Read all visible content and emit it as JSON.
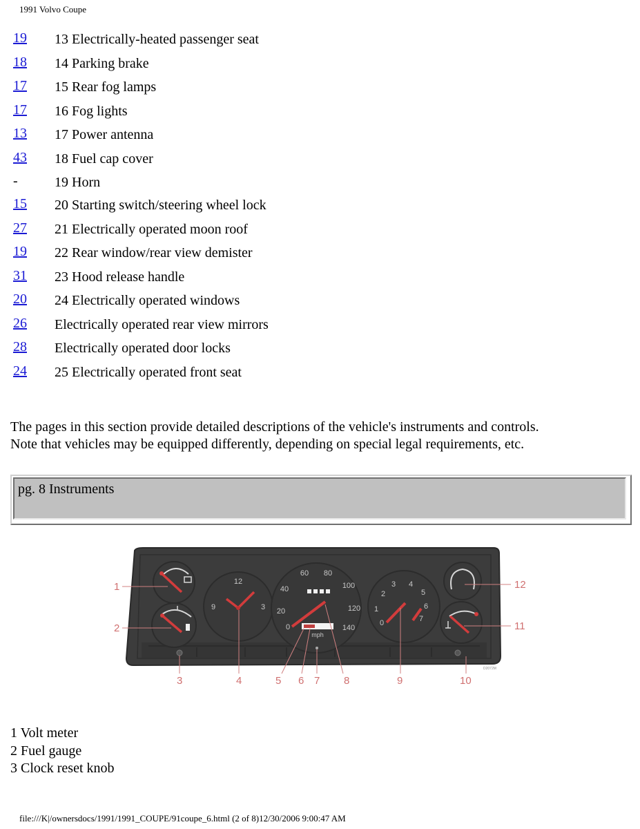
{
  "header": {
    "title": "1991 Volvo Coupe"
  },
  "references": [
    {
      "page": "19",
      "link": true,
      "text": "13 Electrically-heated passenger seat"
    },
    {
      "page": "18",
      "link": true,
      "text": "14 Parking brake"
    },
    {
      "page": "17",
      "link": true,
      "text": "15 Rear fog lamps"
    },
    {
      "page": "17",
      "link": true,
      "text": "16 Fog lights"
    },
    {
      "page": "13",
      "link": true,
      "text": "17 Power antenna"
    },
    {
      "page": "43",
      "link": true,
      "text": "18 Fuel cap cover"
    },
    {
      "page": "-",
      "link": false,
      "text": "19 Horn"
    },
    {
      "page": "15",
      "link": true,
      "text": "20 Starting switch/steering wheel lock"
    },
    {
      "page": "27",
      "link": true,
      "text": "21 Electrically operated moon roof"
    },
    {
      "page": "19",
      "link": true,
      "text": "22 Rear window/rear view demister"
    },
    {
      "page": "31",
      "link": true,
      "text": "23 Hood release handle"
    },
    {
      "page": "20",
      "link": true,
      "text": "24 Electrically operated windows"
    },
    {
      "page": "26",
      "link": true,
      "text": "Electrically operated rear view mirrors"
    },
    {
      "page": "28",
      "link": true,
      "text": "Electrically operated door locks"
    },
    {
      "page": "24",
      "link": true,
      "text": "25 Electrically operated front seat"
    }
  ],
  "intro": {
    "line1": "The pages in this section provide detailed descriptions of the vehicle's instruments and controls.",
    "line2": "Note that vehicles may be equipped differently, depending on special legal requirements, etc."
  },
  "section": {
    "title": "pg. 8 Instruments"
  },
  "figure": {
    "callouts": [
      "1",
      "2",
      "3",
      "4",
      "5",
      "6",
      "7",
      "8",
      "9",
      "10",
      "11",
      "12"
    ],
    "clock_numbers": [
      "12",
      "3",
      "9"
    ],
    "speedo_numbers": [
      "0",
      "20",
      "40",
      "60",
      "80",
      "100",
      "120",
      "140"
    ],
    "speedo_unit": "mph",
    "tacho_numbers": [
      "0",
      "1",
      "2",
      "3",
      "4",
      "5",
      "6",
      "7"
    ],
    "image_code": "D2072M"
  },
  "captions": [
    "1 Volt meter",
    "2 Fuel gauge",
    "3 Clock reset knob"
  ],
  "footer": {
    "text": "file:///K|/ownersdocs/1991/1991_COUPE/91coupe_6.html (2 of 8)12/30/2006 9:00:47 AM"
  }
}
